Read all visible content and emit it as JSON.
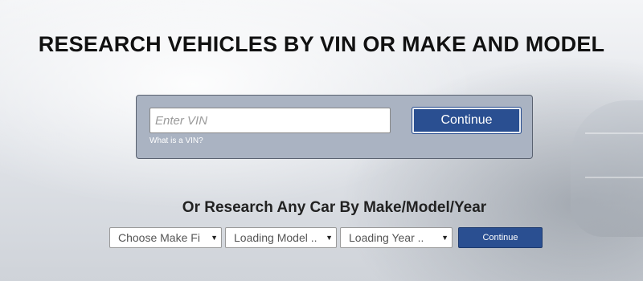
{
  "page": {
    "title": "RESEARCH VEHICLES BY VIN OR MAKE AND MODEL"
  },
  "vin_search": {
    "placeholder": "Enter VIN",
    "value": "",
    "help_link": "What is a VIN?",
    "continue_label": "Continue"
  },
  "make_model_search": {
    "heading": "Or Research Any Car By Make/Model/Year",
    "make_select": "Choose Make Fi",
    "model_select": "Loading Model ..",
    "year_select": "Loading Year ..",
    "continue_label": "Continue"
  },
  "colors": {
    "button_blue": "#2a4f91",
    "vin_panel": "#aab3c2"
  },
  "icons": {
    "select_arrow": "chevron-down-icon"
  }
}
